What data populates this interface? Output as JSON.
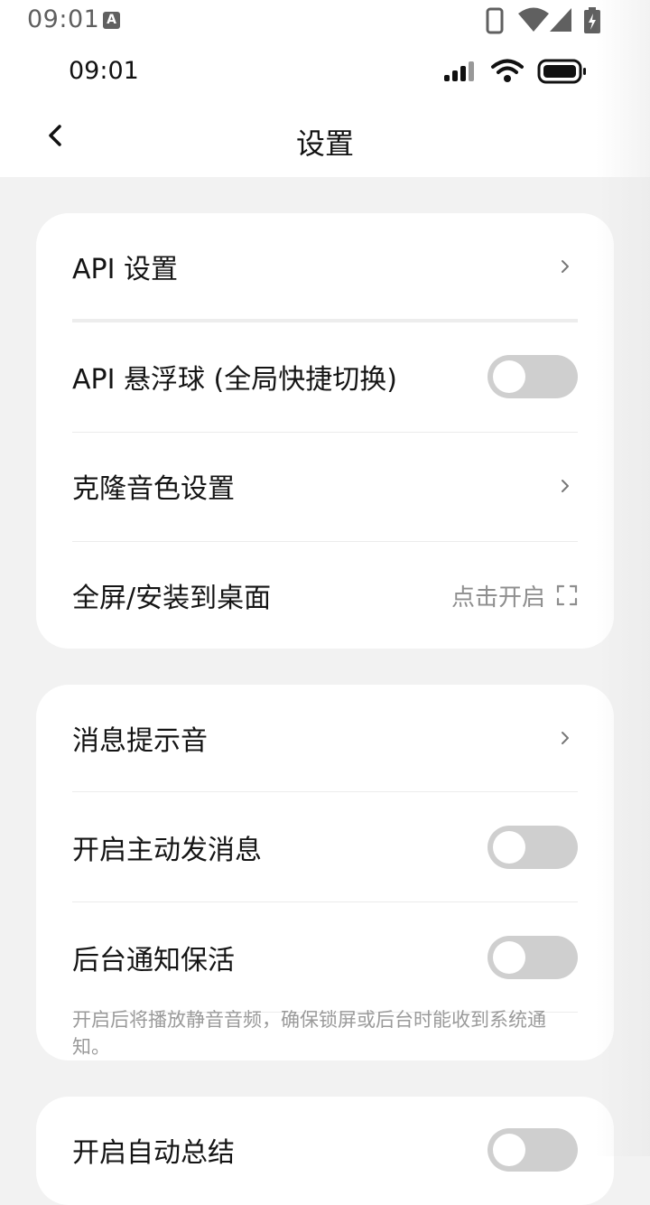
{
  "system_bar": {
    "time": "09:01",
    "keyboard_badge": "A",
    "icons": [
      "phone-icon",
      "wifi-icon",
      "signal-icon",
      "battery-charging-icon"
    ]
  },
  "web_status": {
    "time": "09:01",
    "icons": [
      "cell-signal-icon",
      "wifi-icon",
      "battery-icon"
    ]
  },
  "header": {
    "title": "设置"
  },
  "card1": {
    "api_settings": "API 设置",
    "api_float_ball": "API 悬浮球 (全局快捷切换)",
    "api_float_ball_on": false,
    "voice_clone": "克隆音色设置",
    "fullscreen": "全屏/安装到桌面",
    "fullscreen_hint": "点击开启"
  },
  "card2": {
    "message_sound": "消息提示音",
    "active_message": "开启主动发消息",
    "active_message_on": false,
    "background_keepalive": "后台通知保活",
    "background_keepalive_on": false,
    "keepalive_note": "开启后将播放静音音频，确保锁屏或后台时能收到系统通知。"
  },
  "card3": {
    "auto_summary": "开启自动总结",
    "auto_summary_on": false
  },
  "colors": {
    "background": "#f2f2f2",
    "card": "#ffffff",
    "toggle_off": "#cfcfcf",
    "hint_text": "#8e8e8e"
  }
}
